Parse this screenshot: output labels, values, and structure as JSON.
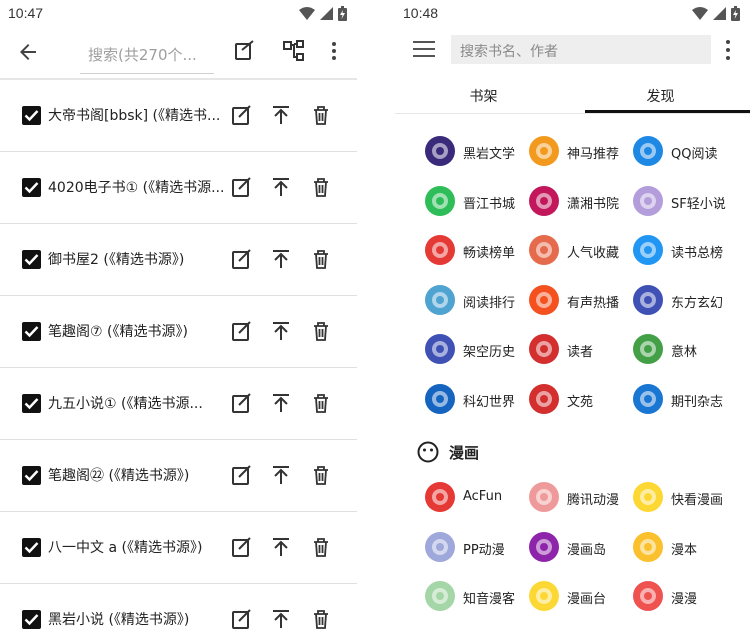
{
  "left": {
    "status_time": "10:47",
    "search_placeholder": "搜索(共270个...",
    "rows": [
      {
        "label": "大帝书阁[bbsk] (《精选书..."
      },
      {
        "label": "4020电子书① (《精选书源..."
      },
      {
        "label": "御书屋2 (《精选书源》)"
      },
      {
        "label": "笔趣阁⑦ (《精选书源》)"
      },
      {
        "label": "九五小说① (《精选书源..."
      },
      {
        "label": "笔趣阁㉒ (《精选书源》)"
      },
      {
        "label": "八一中文 a (《精选书源》)"
      },
      {
        "label": "黑岩小说 (《精选书源》)"
      }
    ]
  },
  "right": {
    "status_time": "10:48",
    "search_placeholder": "搜索书名、作者",
    "tabs": [
      {
        "label": "书架"
      },
      {
        "label": "发现"
      }
    ],
    "sources": [
      {
        "label": "黑岩文学",
        "color": "#3a2a7a"
      },
      {
        "label": "神马推荐",
        "color": "#f29a1e"
      },
      {
        "label": "QQ阅读",
        "color": "#1e88e5"
      },
      {
        "label": "晋江书城",
        "color": "#2ebd59"
      },
      {
        "label": "潇湘书院",
        "color": "#c2185b"
      },
      {
        "label": "SF轻小说",
        "color": "#b39ddb"
      },
      {
        "label": "畅读榜单",
        "color": "#e53935"
      },
      {
        "label": "人气收藏",
        "color": "#e66a4c"
      },
      {
        "label": "读书总榜",
        "color": "#2196f3"
      },
      {
        "label": "阅读排行",
        "color": "#4fa3d1"
      },
      {
        "label": "有声热播",
        "color": "#f4511e"
      },
      {
        "label": "东方玄幻",
        "color": "#3f51b5"
      },
      {
        "label": "架空历史",
        "color": "#3f51b5"
      },
      {
        "label": "读者",
        "color": "#d32f2f"
      },
      {
        "label": "意林",
        "color": "#43a047"
      },
      {
        "label": "科幻世界",
        "color": "#1565c0"
      },
      {
        "label": "文苑",
        "color": "#d32f2f"
      },
      {
        "label": "期刊杂志",
        "color": "#1976d2"
      }
    ],
    "comic_section_title": "漫画",
    "comics": [
      {
        "label": "AcFun",
        "color": "#e53935"
      },
      {
        "label": "腾讯动漫",
        "color": "#ef9a9a"
      },
      {
        "label": "快看漫画",
        "color": "#fdd835"
      },
      {
        "label": "PP动漫",
        "color": "#9fa8da"
      },
      {
        "label": "漫画岛",
        "color": "#8e24aa"
      },
      {
        "label": "漫本",
        "color": "#fbc02d"
      },
      {
        "label": "知音漫客",
        "color": "#a5d6a7"
      },
      {
        "label": "漫画台",
        "color": "#fdd835"
      },
      {
        "label": "漫漫",
        "color": "#ef5350"
      }
    ]
  }
}
